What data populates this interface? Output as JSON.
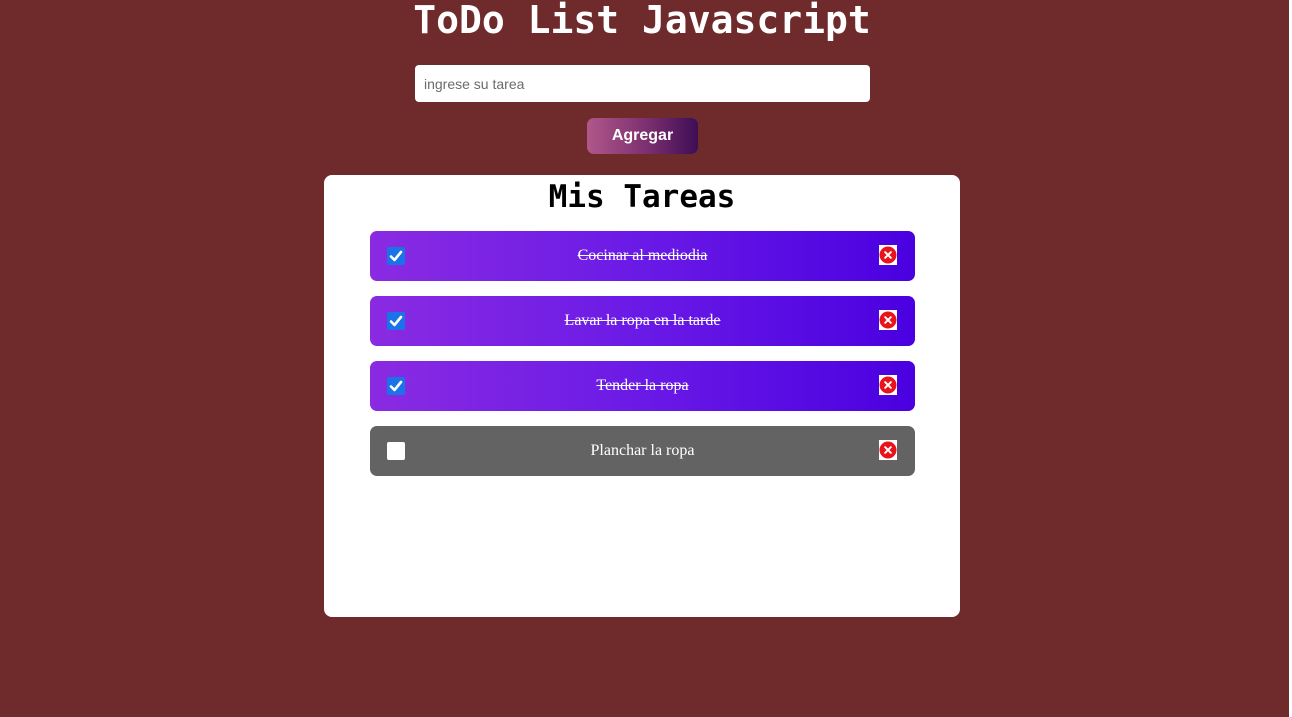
{
  "header": {
    "title": "ToDo List Javascript"
  },
  "form": {
    "input_placeholder": "ingrese su tarea",
    "input_value": "",
    "add_label": "Agregar"
  },
  "panel": {
    "title": "Mis Tareas",
    "tasks": [
      {
        "text": "Cocinar al mediodia",
        "completed": true
      },
      {
        "text": "Lavar la ropa en la tarde",
        "completed": true
      },
      {
        "text": "Tender la ropa",
        "completed": true
      },
      {
        "text": "Planchar la ropa",
        "completed": false
      }
    ]
  },
  "icons": {
    "checkbox": "checkmark-icon",
    "delete": "close-circle-icon"
  },
  "colors": {
    "background": "#6f2a2c",
    "panel": "#ffffff",
    "task_done_gradient": [
      "#8a2be2",
      "#4a00e0"
    ],
    "task_pending": "#636363",
    "checkbox_checked": "#1a73e8",
    "delete_icon": "#e8141c",
    "add_button_gradient": [
      "#b0578a",
      "#3e0d55"
    ]
  }
}
